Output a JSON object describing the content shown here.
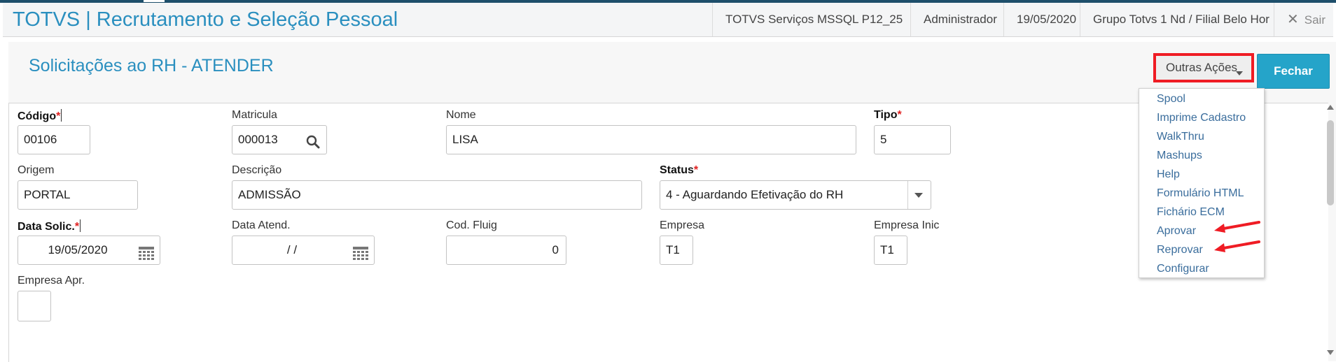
{
  "header": {
    "app_title": "TOTVS | Recrutamento e Seleção Pessoal",
    "server": "TOTVS Serviços MSSQL P12_25",
    "user": "Administrador",
    "date": "19/05/2020",
    "branch": "Grupo Totvs 1 Nd / Filial Belo Hor",
    "exit_label": "Sair"
  },
  "page": {
    "title": "Solicitações ao RH - ATENDER",
    "other_actions_label": "Outras Ações",
    "close_label": "Fechar"
  },
  "form": {
    "codigo": {
      "label": "Código",
      "value": "00106"
    },
    "matricula": {
      "label": "Matricula",
      "value": "000013"
    },
    "nome": {
      "label": "Nome",
      "value": "LISA"
    },
    "tipo": {
      "label": "Tipo",
      "value": "5"
    },
    "origem": {
      "label": "Origem",
      "value": "PORTAL"
    },
    "descricao": {
      "label": "Descrição",
      "value": "ADMISSÃO"
    },
    "status": {
      "label": "Status",
      "value": "4 - Aguardando Efetivação do RH"
    },
    "data_solic": {
      "label": "Data Solic.",
      "value": "19/05/2020"
    },
    "data_atend": {
      "label": "Data Atend.",
      "value": "/ /"
    },
    "cod_fluig": {
      "label": "Cod. Fluig",
      "value": "0"
    },
    "empresa": {
      "label": "Empresa",
      "value": "T1"
    },
    "empresa_inic": {
      "label": "Empresa Inic",
      "value": "T1"
    },
    "empresa_apr": {
      "label": "Empresa Apr.",
      "value": ""
    },
    "required_marker": "*"
  },
  "menu": {
    "items": [
      "Spool",
      "Imprime Cadastro",
      "WalkThru",
      "Mashups",
      "Help",
      "Formulário HTML",
      "Fichário ECM",
      "Aprovar",
      "Reprovar",
      "Configurar"
    ]
  },
  "colors": {
    "brand": "#2a8fbf",
    "close_button": "#25a4c9",
    "highlight": "#ef1c24",
    "menu_text": "#3a6d9c"
  },
  "icons": {
    "search": "search-icon",
    "calendar": "calendar-icon",
    "close": "close-icon",
    "dropdown": "chevron-down-icon",
    "annotation": "red-arrow-annotation"
  }
}
